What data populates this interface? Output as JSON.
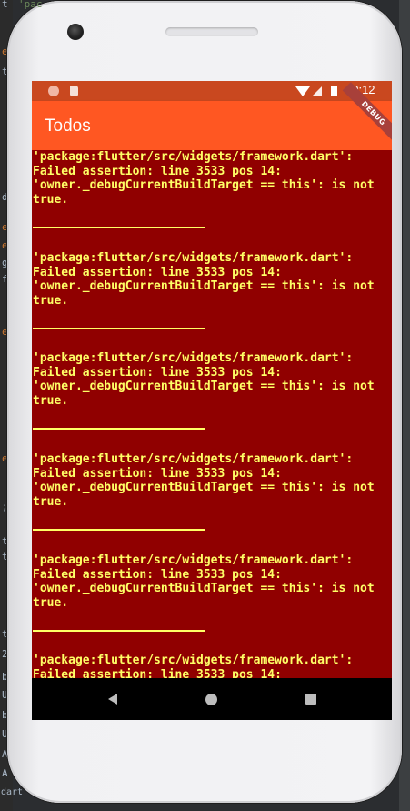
{
  "ide": {
    "fragments_left": [
      "t",
      "e",
      "t",
      "d",
      "e",
      "e",
      "g",
      "f",
      "e",
      "e",
      ";",
      "t",
      "t",
      "t",
      "2",
      "b",
      "U",
      "b",
      "U",
      "dart",
      "A",
      "A"
    ],
    "top_text": "'pac"
  },
  "status_bar": {
    "time": "10:12",
    "icons": [
      "notification-circle-icon",
      "sd-card-icon",
      "wifi-icon",
      "signal-icon",
      "battery-icon"
    ]
  },
  "app_bar": {
    "title": "Todos",
    "debug_banner": "DEBUG",
    "color": "#ff5722"
  },
  "error": {
    "background": "#900000",
    "text_color": "#ffff66",
    "blocks": [
      {
        "text": "'package:flutter/src/widgets/framework.dart':\nFailed assertion: line 3533 pos 14:\n'owner._debugCurrentBuildTarget == this': is not\ntrue."
      },
      {
        "text": "'package:flutter/src/widgets/framework.dart':\nFailed assertion: line 3533 pos 14:\n'owner._debugCurrentBuildTarget == this': is not\ntrue."
      },
      {
        "text": "'package:flutter/src/widgets/framework.dart':\nFailed assertion: line 3533 pos 14:\n'owner._debugCurrentBuildTarget == this': is not\ntrue."
      },
      {
        "text": "'package:flutter/src/widgets/framework.dart':\nFailed assertion: line 3533 pos 14:\n'owner._debugCurrentBuildTarget == this': is not\ntrue."
      },
      {
        "text": "'package:flutter/src/widgets/framework.dart':\nFailed assertion: line 3533 pos 14:\n'owner._debugCurrentBuildTarget == this': is not\ntrue."
      },
      {
        "text": "'package:flutter/src/widgets/framework.dart':\nFailed assertion: line 3533 pos 14:"
      }
    ]
  },
  "nav_bar": {
    "buttons": [
      "back-icon",
      "home-icon",
      "recents-icon"
    ]
  }
}
